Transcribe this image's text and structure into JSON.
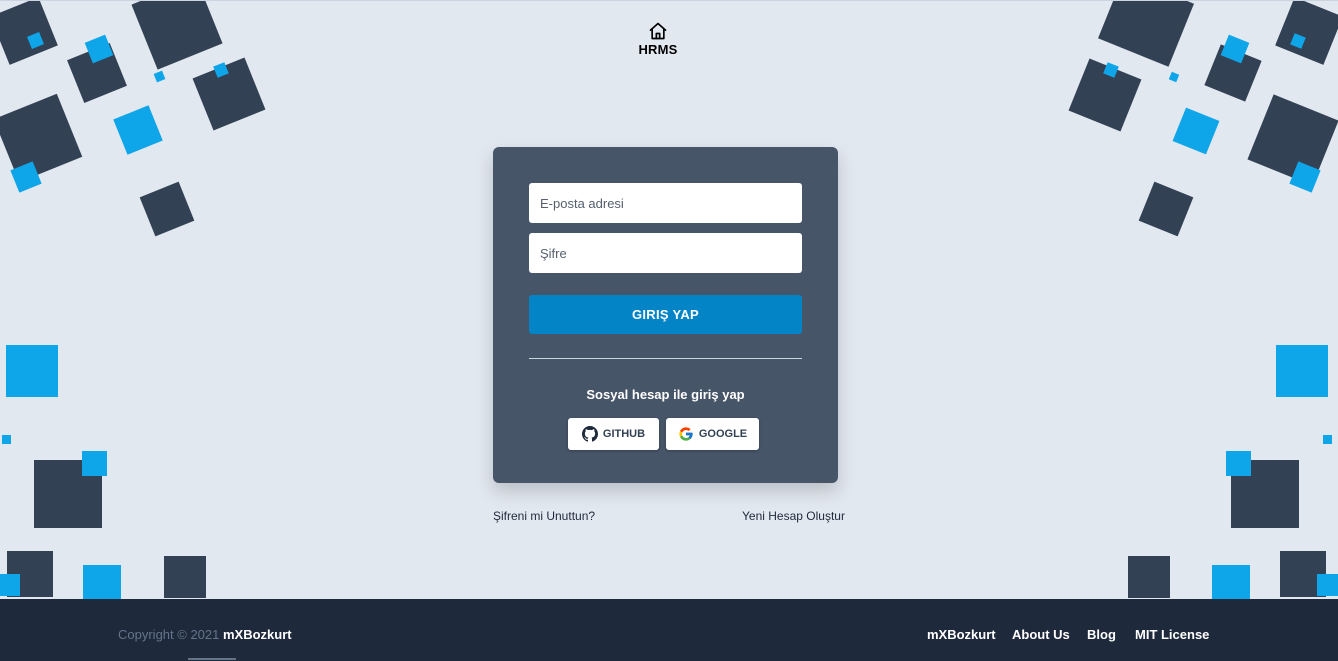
{
  "brand": {
    "name": "HRMS",
    "icon": "home-icon"
  },
  "login": {
    "email_placeholder": "E-posta adresi",
    "password_placeholder": "Şifre",
    "submit_label": "GIRIŞ YAP",
    "social_title": "Sosyal hesap ile giriş yap",
    "github_label": "GITHUB",
    "google_label": "GOOGLE"
  },
  "links": {
    "forgot": "Şifreni mi Unuttun?",
    "signup": "Yeni Hesap Oluştur"
  },
  "footer": {
    "copyright_prefix": "Copyright © 2021",
    "copyright_owner": "mXBozkurt",
    "nav": [
      "mXBozkurt",
      "About Us",
      "Blog",
      "MIT License"
    ]
  },
  "colors": {
    "background": "#e2e8f0",
    "card": "#475569",
    "primary_button": "#0284c7",
    "decor_dark": "#334155",
    "decor_blue": "#0ea5e9",
    "footer": "#1e293b"
  }
}
